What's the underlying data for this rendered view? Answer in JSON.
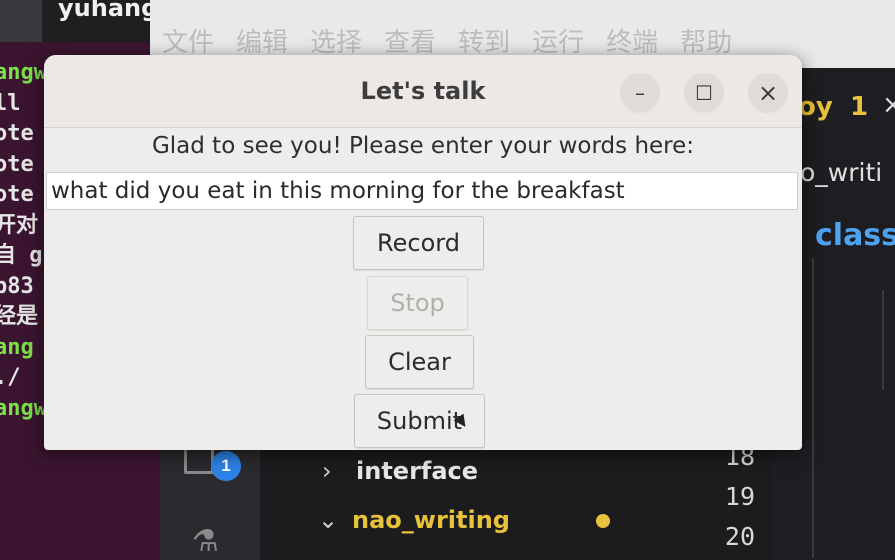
{
  "terminal": {
    "tab_title": "yuhang",
    "lines": [
      {
        "text": "angw",
        "color": "green"
      },
      {
        "text": "ll",
        "color": "white"
      },
      {
        "text": "ote",
        "color": "white"
      },
      {
        "text": "ote",
        "color": "white"
      },
      {
        "text": "ote",
        "color": "white"
      },
      {
        "text": "开对",
        "color": "white"
      },
      {
        "text": "自 g",
        "color": "white"
      },
      {
        "text": "b83",
        "color": "white"
      },
      {
        "text": "经是",
        "color": "white"
      },
      {
        "text": "ang",
        "color": "green"
      },
      {
        "text": "./",
        "color": "white"
      },
      {
        "text": "angw@yuha",
        "color": "green"
      }
    ]
  },
  "editor": {
    "menu": [
      "文件",
      "编辑",
      "选择",
      "查看",
      "转到",
      "运行",
      "终端",
      "帮助"
    ],
    "tab_text": "oy",
    "tab_count": "1",
    "breadcrumb": "o_writi",
    "code_keyword": "class",
    "activity_badge": "1",
    "explorer": {
      "items": [
        {
          "label": "interface",
          "expanded": false
        },
        {
          "label": "nao_writing",
          "expanded": true,
          "modified": true
        }
      ]
    },
    "line_numbers": [
      "18",
      "19",
      "20"
    ]
  },
  "dialog": {
    "title": "Let's talk",
    "prompt": "Glad to see you! Please enter your words here:",
    "entry_value": "what did you eat in this morning for the breakfast",
    "buttons": {
      "record": "Record",
      "stop": "Stop",
      "clear": "Clear",
      "submit": "Submit"
    },
    "stop_disabled": true
  },
  "colors": {
    "terminal_bg": "#3b1530",
    "terminal_green": "#7ee04a",
    "editor_bg": "#1e1e22",
    "accent_yellow": "#e8c23a",
    "accent_blue": "#2c82e6",
    "dialog_bg": "#efedeb"
  }
}
